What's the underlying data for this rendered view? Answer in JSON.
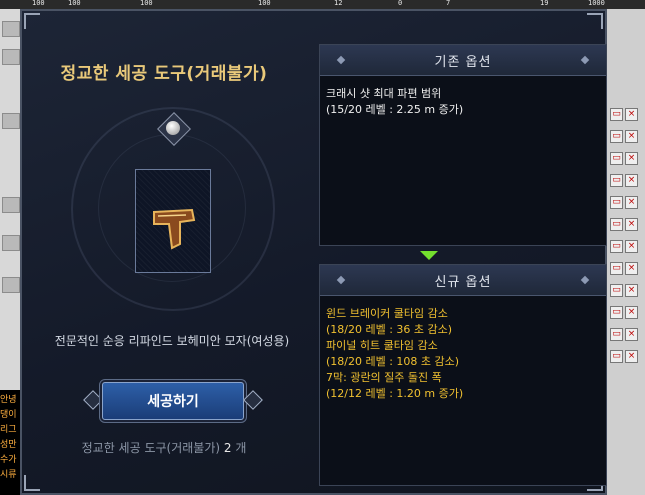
{
  "hud": {
    "top_values": [
      "100",
      "100",
      "100",
      "100",
      "12",
      "0",
      "7",
      "19",
      "1000"
    ]
  },
  "background_chat": [
    "안녕",
    "댕이",
    "리그",
    "성만",
    "수가",
    "시류"
  ],
  "window": {
    "title": "정교한 세공 도구(거래불가)",
    "item_name": "전문적인 순응 리파인드 보헤미안 모자(여성용)",
    "craft_button": "세공하기",
    "tool_count_label": "정교한 세공 도구(거래불가)",
    "tool_count_value": "2",
    "tool_count_unit": "개"
  },
  "existing_options": {
    "header": "기존 옵션",
    "lines": [
      "크래시 샷 최대 파편 범위",
      "(15/20 레벨 : 2.25 m 증가)"
    ]
  },
  "new_options": {
    "header": "신규 옵션",
    "lines": [
      "윈드 브레이커 쿨타임 감소",
      "(18/20 레벨 : 36 초 감소)",
      "파이널 히트 쿨타임 감소",
      "(18/20 레벨 : 108 초 감소)",
      "7막: 광란의 질주 돌진 폭",
      "(12/12 레벨 : 1.20 m 증가)"
    ]
  },
  "colors": {
    "title": "#e9c97a",
    "new_option_text": "#f0c030",
    "button_blue": "#2d5fa8",
    "arrow_green": "#74e02e"
  },
  "icons": [
    "diamond-gem-icon",
    "item-thumbnail-icon",
    "arrow-down-icon",
    "close-icon",
    "minimize-icon"
  ]
}
